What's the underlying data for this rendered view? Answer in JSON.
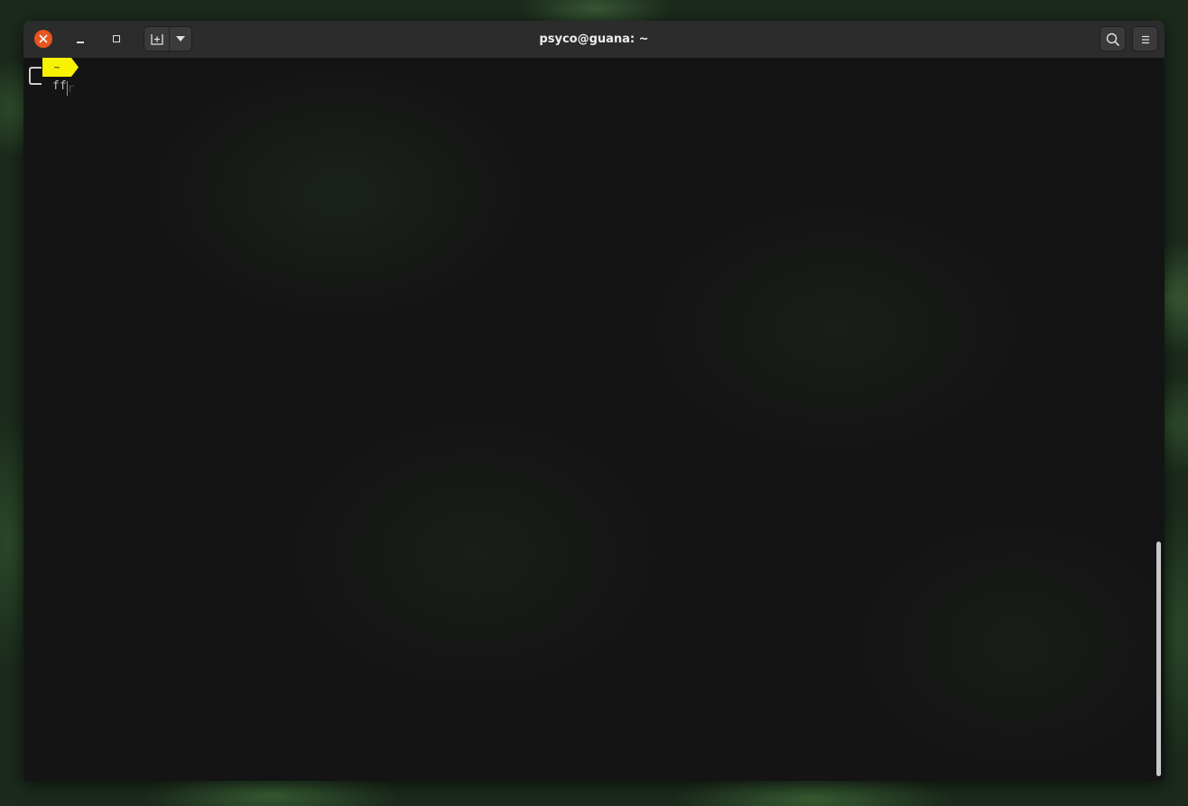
{
  "window": {
    "title": "psyco@guana: ~"
  },
  "headerbar": {
    "close_icon": "close-icon",
    "minimize_icon": "minimize-icon",
    "maximize_icon": "maximize-icon",
    "new_tab_icon": "new-tab-icon",
    "tab_menu_icon": "chevron-down-icon",
    "search_icon": "search-icon",
    "menu_icon": "hamburger-menu-icon"
  },
  "terminal": {
    "prompt_dir": "~",
    "typed_command": "ff",
    "cursor_char": "r"
  },
  "colors": {
    "prompt_segment": "#f6f200",
    "close_button": "#e9541f",
    "headerbar": "#2c2c2c",
    "terminal_bg": "#141414"
  }
}
